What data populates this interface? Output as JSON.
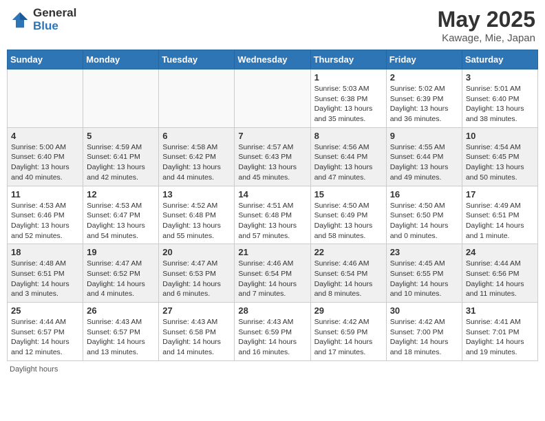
{
  "header": {
    "logo_general": "General",
    "logo_blue": "Blue",
    "month_year": "May 2025",
    "location": "Kawage, Mie, Japan"
  },
  "weekdays": [
    "Sunday",
    "Monday",
    "Tuesday",
    "Wednesday",
    "Thursday",
    "Friday",
    "Saturday"
  ],
  "weeks": [
    [
      {
        "day": "",
        "info": "",
        "empty": true
      },
      {
        "day": "",
        "info": "",
        "empty": true
      },
      {
        "day": "",
        "info": "",
        "empty": true
      },
      {
        "day": "",
        "info": "",
        "empty": true
      },
      {
        "day": "1",
        "info": "Sunrise: 5:03 AM\nSunset: 6:38 PM\nDaylight: 13 hours\nand 35 minutes."
      },
      {
        "day": "2",
        "info": "Sunrise: 5:02 AM\nSunset: 6:39 PM\nDaylight: 13 hours\nand 36 minutes."
      },
      {
        "day": "3",
        "info": "Sunrise: 5:01 AM\nSunset: 6:40 PM\nDaylight: 13 hours\nand 38 minutes."
      }
    ],
    [
      {
        "day": "4",
        "info": "Sunrise: 5:00 AM\nSunset: 6:40 PM\nDaylight: 13 hours\nand 40 minutes."
      },
      {
        "day": "5",
        "info": "Sunrise: 4:59 AM\nSunset: 6:41 PM\nDaylight: 13 hours\nand 42 minutes."
      },
      {
        "day": "6",
        "info": "Sunrise: 4:58 AM\nSunset: 6:42 PM\nDaylight: 13 hours\nand 44 minutes."
      },
      {
        "day": "7",
        "info": "Sunrise: 4:57 AM\nSunset: 6:43 PM\nDaylight: 13 hours\nand 45 minutes."
      },
      {
        "day": "8",
        "info": "Sunrise: 4:56 AM\nSunset: 6:44 PM\nDaylight: 13 hours\nand 47 minutes."
      },
      {
        "day": "9",
        "info": "Sunrise: 4:55 AM\nSunset: 6:44 PM\nDaylight: 13 hours\nand 49 minutes."
      },
      {
        "day": "10",
        "info": "Sunrise: 4:54 AM\nSunset: 6:45 PM\nDaylight: 13 hours\nand 50 minutes."
      }
    ],
    [
      {
        "day": "11",
        "info": "Sunrise: 4:53 AM\nSunset: 6:46 PM\nDaylight: 13 hours\nand 52 minutes."
      },
      {
        "day": "12",
        "info": "Sunrise: 4:53 AM\nSunset: 6:47 PM\nDaylight: 13 hours\nand 54 minutes."
      },
      {
        "day": "13",
        "info": "Sunrise: 4:52 AM\nSunset: 6:48 PM\nDaylight: 13 hours\nand 55 minutes."
      },
      {
        "day": "14",
        "info": "Sunrise: 4:51 AM\nSunset: 6:48 PM\nDaylight: 13 hours\nand 57 minutes."
      },
      {
        "day": "15",
        "info": "Sunrise: 4:50 AM\nSunset: 6:49 PM\nDaylight: 13 hours\nand 58 minutes."
      },
      {
        "day": "16",
        "info": "Sunrise: 4:50 AM\nSunset: 6:50 PM\nDaylight: 14 hours\nand 0 minutes."
      },
      {
        "day": "17",
        "info": "Sunrise: 4:49 AM\nSunset: 6:51 PM\nDaylight: 14 hours\nand 1 minute."
      }
    ],
    [
      {
        "day": "18",
        "info": "Sunrise: 4:48 AM\nSunset: 6:51 PM\nDaylight: 14 hours\nand 3 minutes."
      },
      {
        "day": "19",
        "info": "Sunrise: 4:47 AM\nSunset: 6:52 PM\nDaylight: 14 hours\nand 4 minutes."
      },
      {
        "day": "20",
        "info": "Sunrise: 4:47 AM\nSunset: 6:53 PM\nDaylight: 14 hours\nand 6 minutes."
      },
      {
        "day": "21",
        "info": "Sunrise: 4:46 AM\nSunset: 6:54 PM\nDaylight: 14 hours\nand 7 minutes."
      },
      {
        "day": "22",
        "info": "Sunrise: 4:46 AM\nSunset: 6:54 PM\nDaylight: 14 hours\nand 8 minutes."
      },
      {
        "day": "23",
        "info": "Sunrise: 4:45 AM\nSunset: 6:55 PM\nDaylight: 14 hours\nand 10 minutes."
      },
      {
        "day": "24",
        "info": "Sunrise: 4:44 AM\nSunset: 6:56 PM\nDaylight: 14 hours\nand 11 minutes."
      }
    ],
    [
      {
        "day": "25",
        "info": "Sunrise: 4:44 AM\nSunset: 6:57 PM\nDaylight: 14 hours\nand 12 minutes."
      },
      {
        "day": "26",
        "info": "Sunrise: 4:43 AM\nSunset: 6:57 PM\nDaylight: 14 hours\nand 13 minutes."
      },
      {
        "day": "27",
        "info": "Sunrise: 4:43 AM\nSunset: 6:58 PM\nDaylight: 14 hours\nand 14 minutes."
      },
      {
        "day": "28",
        "info": "Sunrise: 4:43 AM\nSunset: 6:59 PM\nDaylight: 14 hours\nand 16 minutes."
      },
      {
        "day": "29",
        "info": "Sunrise: 4:42 AM\nSunset: 6:59 PM\nDaylight: 14 hours\nand 17 minutes."
      },
      {
        "day": "30",
        "info": "Sunrise: 4:42 AM\nSunset: 7:00 PM\nDaylight: 14 hours\nand 18 minutes."
      },
      {
        "day": "31",
        "info": "Sunrise: 4:41 AM\nSunset: 7:01 PM\nDaylight: 14 hours\nand 19 minutes."
      }
    ]
  ],
  "footer": {
    "daylight_label": "Daylight hours"
  }
}
